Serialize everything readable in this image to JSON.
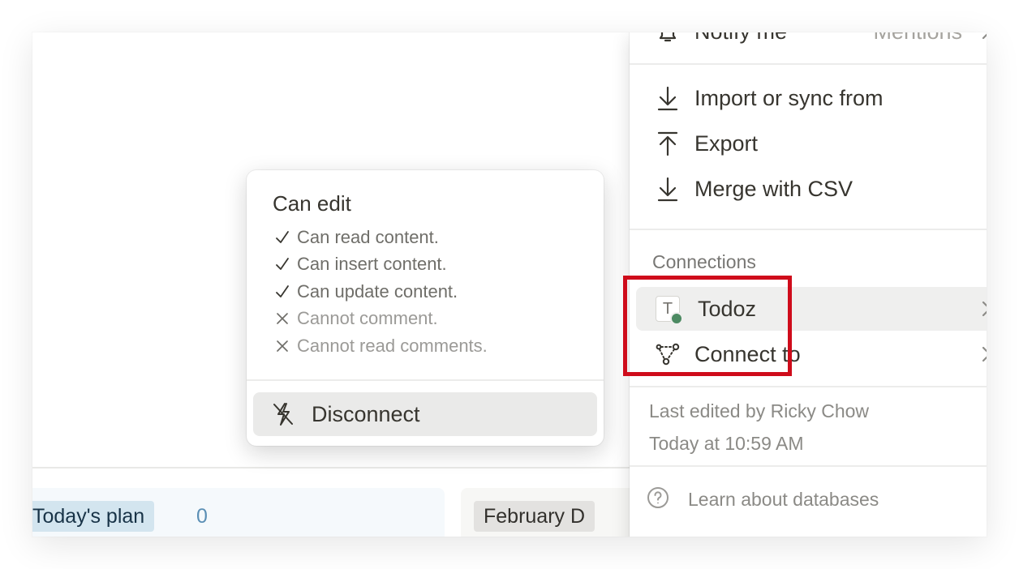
{
  "board": {
    "groups": [
      {
        "name": "Today's plan",
        "count": "0"
      },
      {
        "name": "February D"
      }
    ]
  },
  "menu": {
    "notify": {
      "label": "Notify me",
      "value": "Mentions"
    },
    "import_label": "Import or sync from",
    "export_label": "Export",
    "merge_label": "Merge with CSV",
    "connections_title": "Connections",
    "connections": [
      {
        "label": "Todoz",
        "logo_letter": "T",
        "status_color": "#4c8a62"
      },
      {
        "label": "Connect to"
      }
    ],
    "last_edited_by": "Last edited by Ricky Chow",
    "last_edited_time": "Today at 10:59 AM",
    "learn_label": "Learn about databases"
  },
  "permissions": {
    "title": "Can edit",
    "items": [
      {
        "text": "Can read content.",
        "allowed": true
      },
      {
        "text": "Can insert content.",
        "allowed": true
      },
      {
        "text": "Can update content.",
        "allowed": true
      },
      {
        "text": "Cannot comment.",
        "allowed": false
      },
      {
        "text": "Cannot read comments.",
        "allowed": false
      }
    ],
    "disconnect_label": "Disconnect"
  },
  "colors": {
    "highlight": "#cf0c1b",
    "today_tag": "#d3e5ef",
    "feb_tag": "#e3e2e0"
  }
}
